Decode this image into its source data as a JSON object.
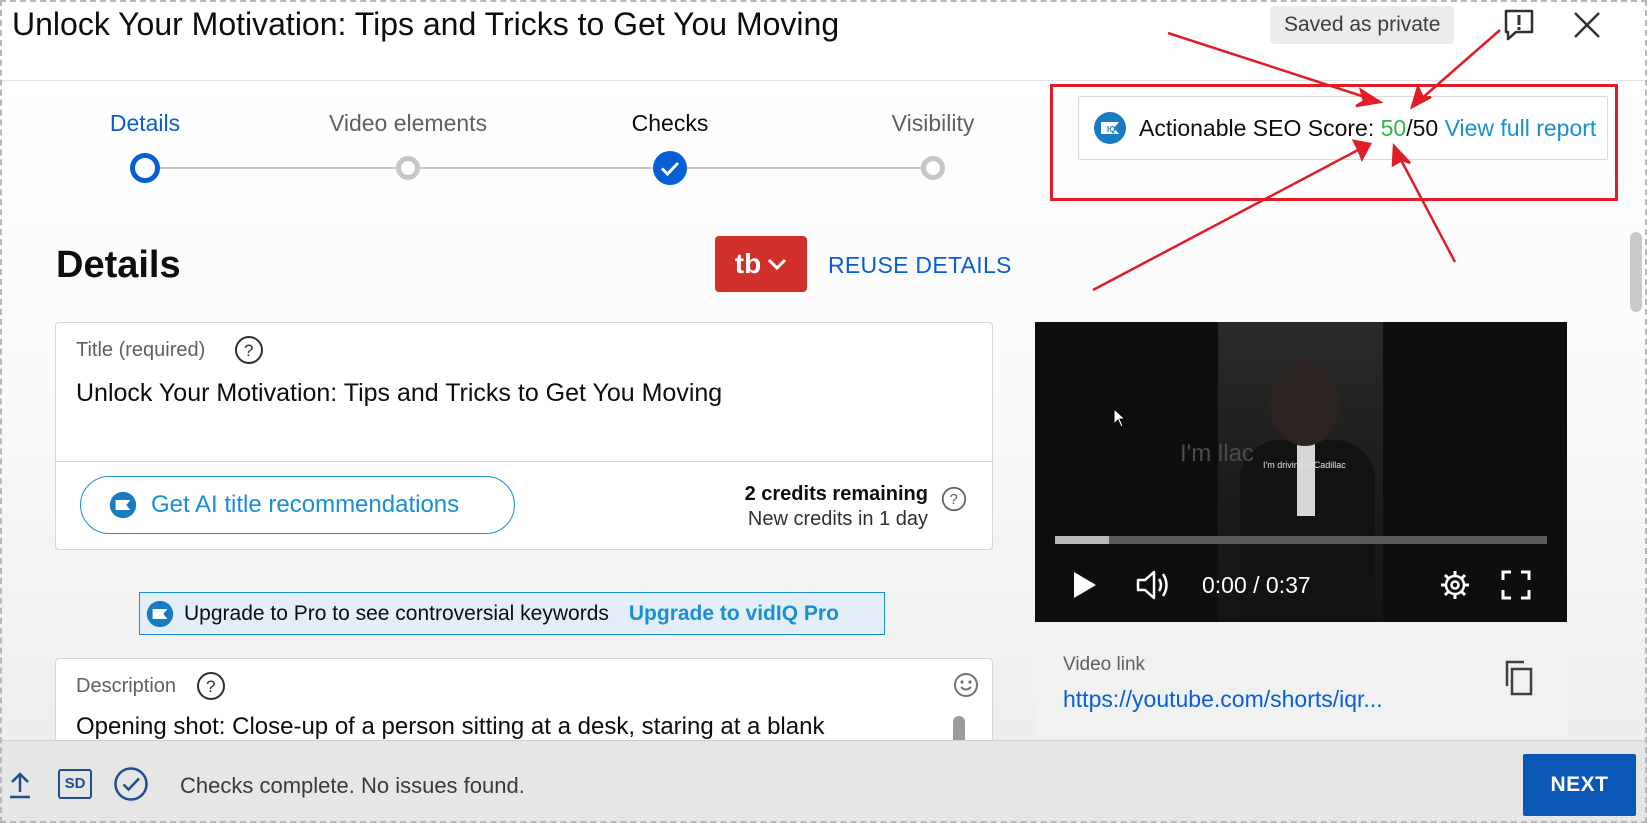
{
  "header": {
    "title": "Unlock Your Motivation: Tips and Tricks to Get You Moving",
    "saved_status": "Saved as private"
  },
  "stepper": {
    "steps": [
      {
        "label": "Details",
        "state": "current"
      },
      {
        "label": "Video elements",
        "state": "pending"
      },
      {
        "label": "Checks",
        "state": "complete"
      },
      {
        "label": "Visibility",
        "state": "pending"
      }
    ]
  },
  "seo": {
    "label": "Actionable SEO Score: ",
    "score": "50",
    "max": "/50",
    "link": "View full report"
  },
  "details": {
    "heading": "Details",
    "tb_label": "tb",
    "reuse_label": "REUSE DETAILS",
    "title_label": "Title (required)",
    "title_value": "Unlock Your Motivation: Tips and Tricks to Get You Moving",
    "ai_button": "Get AI title recommendations",
    "credits_remaining": "2 credits remaining",
    "credits_refresh": "New credits in 1 day",
    "upgrade_text": "Upgrade to Pro to see controversial keywords",
    "upgrade_link": "Upgrade to vidIQ Pro",
    "description_label": "Description",
    "description_value": "Opening shot: Close-up of a person sitting at a desk, staring at a blank"
  },
  "video": {
    "caption_big": "I'm                      llac",
    "caption_small": "I'm driving a Cadillac",
    "time": "0:00 / 0:37",
    "progress_fraction": 0.11,
    "link_label": "Video link",
    "link_url": "https://youtube.com/shorts/iqr..."
  },
  "footer": {
    "sd_label": "SD",
    "status": "Checks complete. No issues found.",
    "next_label": "NEXT"
  },
  "colors": {
    "accent_blue": "#065fd4",
    "vidiq_blue": "#1a8fd1",
    "score_green": "#33b745",
    "annotation_red": "#e01e28",
    "tubebuddy_red": "#d2312b"
  },
  "icons": [
    "feedback-icon",
    "close-icon",
    "help-icon",
    "vidiq-logo-icon",
    "emoji-icon",
    "play-icon",
    "volume-icon",
    "settings-gear-icon",
    "fullscreen-icon",
    "copy-icon",
    "upload-icon",
    "check-circle-icon",
    "chevron-down-icon",
    "cursor-icon"
  ]
}
